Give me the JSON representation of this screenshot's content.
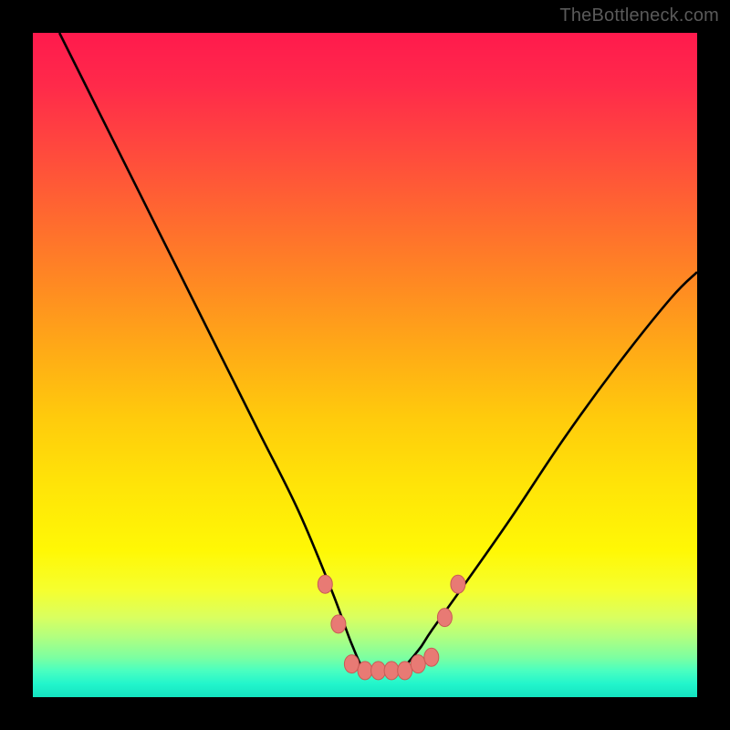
{
  "watermark": "TheBottleneck.com",
  "colors": {
    "frame": "#000000",
    "curve": "#000000",
    "marker_fill": "#e87a74",
    "marker_stroke": "#c95a55"
  },
  "chart_data": {
    "type": "line",
    "title": "",
    "xlabel": "",
    "ylabel": "",
    "xlim": [
      0,
      100
    ],
    "ylim": [
      0,
      100
    ],
    "grid": false,
    "series": [
      {
        "name": "bottleneck-curve",
        "x": [
          4,
          10,
          16,
          22,
          28,
          34,
          40,
          45,
          48,
          50,
          52,
          55,
          58,
          60,
          65,
          72,
          80,
          88,
          96,
          100
        ],
        "y": [
          100,
          88,
          76,
          64,
          52,
          40,
          28,
          16,
          8,
          4,
          4,
          4,
          7,
          10,
          17,
          27,
          39,
          50,
          60,
          64
        ]
      }
    ],
    "markers": [
      {
        "name": "left-shoulder-1",
        "x": 44,
        "y": 17
      },
      {
        "name": "left-shoulder-2",
        "x": 46,
        "y": 11
      },
      {
        "name": "right-shoulder-1",
        "x": 62,
        "y": 12
      },
      {
        "name": "right-shoulder-2",
        "x": 64,
        "y": 17
      },
      {
        "name": "bottom-1",
        "x": 48,
        "y": 5
      },
      {
        "name": "bottom-2",
        "x": 50,
        "y": 4
      },
      {
        "name": "bottom-3",
        "x": 52,
        "y": 4
      },
      {
        "name": "bottom-4",
        "x": 54,
        "y": 4
      },
      {
        "name": "bottom-5",
        "x": 56,
        "y": 4
      },
      {
        "name": "bottom-6",
        "x": 58,
        "y": 5
      },
      {
        "name": "bottom-7",
        "x": 60,
        "y": 6
      }
    ]
  }
}
